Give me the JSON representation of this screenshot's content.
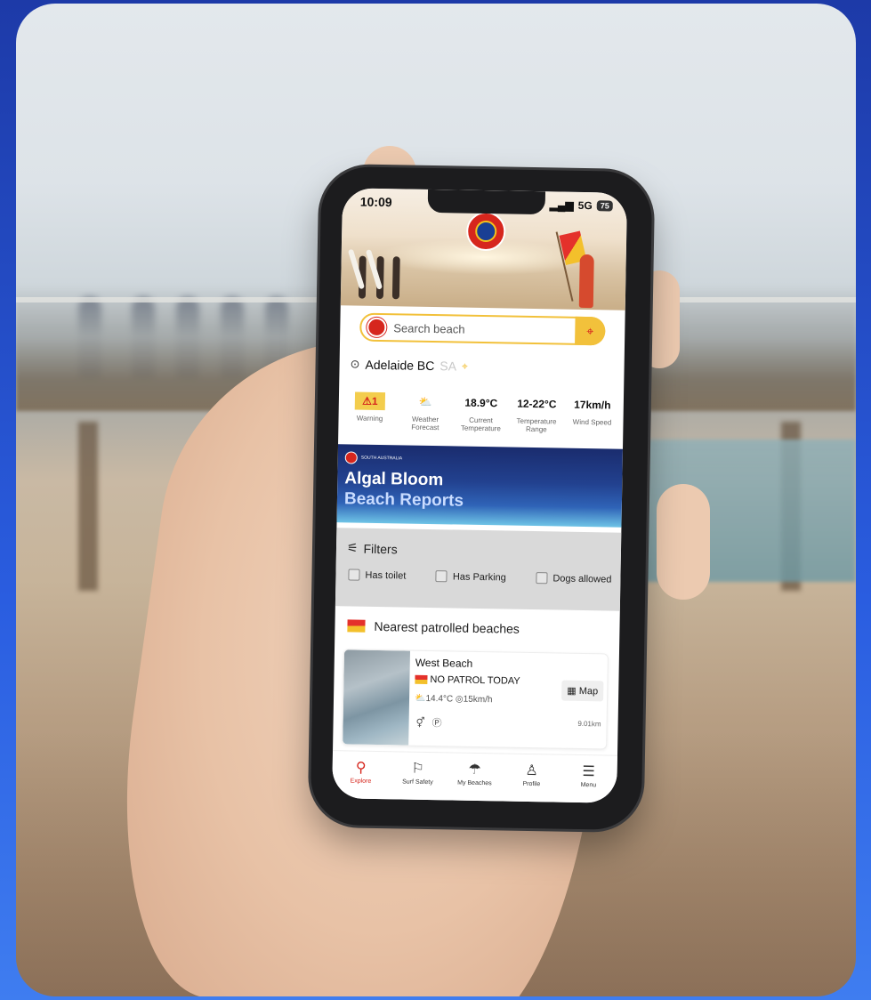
{
  "status_bar": {
    "time": "10:09",
    "network": "5G",
    "battery": "75"
  },
  "search": {
    "placeholder": "Search beach"
  },
  "location": {
    "name": "Adelaide BC",
    "state": "SA"
  },
  "weather": [
    {
      "value": "1",
      "label": "Warning",
      "icon": "warning-icon"
    },
    {
      "value": "",
      "label": "Weather Forecast",
      "icon": "partly-cloudy-icon"
    },
    {
      "value": "18.9°C",
      "label": "Current Temperature"
    },
    {
      "value": "12-22°C",
      "label": "Temperature Range"
    },
    {
      "value": "17km/h",
      "label": "Wind Speed"
    }
  ],
  "banner": {
    "badge": "SOUTH AUSTRALIA",
    "title": "Algal Bloom",
    "subtitle": "Beach Reports"
  },
  "filters": {
    "title": "Filters",
    "options": [
      "Has toilet",
      "Has Parking",
      "Dogs allowed"
    ]
  },
  "nearest": {
    "title": "Nearest patrolled beaches"
  },
  "beach_card": {
    "name": "West Beach",
    "status": "NO PATROL TODAY",
    "temp": "14.4°C",
    "wind": "15km/h",
    "map_label": "Map",
    "distance": "9.01km"
  },
  "tabs": [
    {
      "label": "Explore",
      "icon": "search-icon",
      "active": true
    },
    {
      "label": "Surf Safety",
      "icon": "flag-icon",
      "active": false
    },
    {
      "label": "My Beaches",
      "icon": "umbrella-icon",
      "active": false
    },
    {
      "label": "Profile",
      "icon": "user-icon",
      "active": false
    },
    {
      "label": "Menu",
      "icon": "menu-icon",
      "active": false
    }
  ],
  "colors": {
    "brand_red": "#d6261d",
    "brand_yellow": "#f2c13b",
    "brand_blue": "#1a3f94"
  }
}
